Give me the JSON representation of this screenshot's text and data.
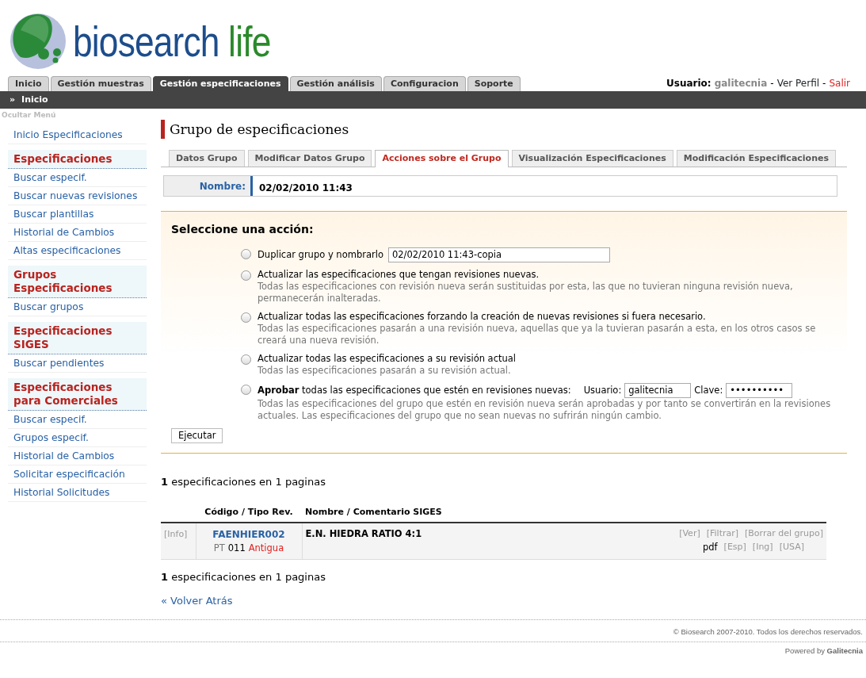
{
  "logo": {
    "word_1": "biosearch",
    "word_2": "life"
  },
  "main_tabs": [
    {
      "label": "Inicio",
      "selected": false
    },
    {
      "label": "Gestión muestras",
      "selected": false
    },
    {
      "label": "Gestión especificaciones",
      "selected": true
    },
    {
      "label": "Gestión análisis",
      "selected": false
    },
    {
      "label": "Configuracion",
      "selected": false
    },
    {
      "label": "Soporte",
      "selected": false
    }
  ],
  "user_bar": {
    "label": "Usuario:",
    "user": "galitecnia",
    "separator_1": "-",
    "profile": "Ver Perfil",
    "separator_2": "-",
    "logout": "Salir"
  },
  "breadcrumb": {
    "arrow": "»",
    "label": "Inicio"
  },
  "hide_menu": "Ocultar Menú",
  "sidebar": {
    "items": [
      {
        "kind": "link",
        "label": "Inicio Especificaciones"
      },
      {
        "kind": "header",
        "label": "Especificaciones"
      },
      {
        "kind": "link",
        "label": "Buscar especif."
      },
      {
        "kind": "link",
        "label": "Buscar nuevas revisiones"
      },
      {
        "kind": "link",
        "label": "Buscar plantillas"
      },
      {
        "kind": "link",
        "label": "Historial de Cambios"
      },
      {
        "kind": "link",
        "label": "Altas especificaciones"
      },
      {
        "kind": "header",
        "label": "Grupos Especificaciones"
      },
      {
        "kind": "link",
        "label": "Buscar grupos"
      },
      {
        "kind": "header",
        "label": "Especificaciones SIGES"
      },
      {
        "kind": "link",
        "label": "Buscar pendientes"
      },
      {
        "kind": "header",
        "label": "Especificaciones para Comerciales"
      },
      {
        "kind": "link",
        "label": "Buscar especif."
      },
      {
        "kind": "link",
        "label": "Grupos especif."
      },
      {
        "kind": "link",
        "label": "Historial de Cambios"
      },
      {
        "kind": "link",
        "label": "Solicitar especificación"
      },
      {
        "kind": "link",
        "label": "Historial Solicitudes"
      }
    ]
  },
  "page_title": "Grupo de especificaciones",
  "group_tabs": [
    {
      "label": "Datos Grupo",
      "selected": false
    },
    {
      "label": "Modificar Datos Grupo",
      "selected": false
    },
    {
      "label": "Acciones sobre el Grupo",
      "selected": true
    },
    {
      "label": "Visualización Especificaciones",
      "selected": false
    },
    {
      "label": "Modificación Especificaciones",
      "selected": false
    }
  ],
  "name_field": {
    "label": "Nombre:",
    "value": "02/02/2010 11:43"
  },
  "actions": {
    "title": "Seleccione una acción:",
    "options": [
      {
        "kind": "duplicate",
        "label": "Duplicar grupo y nombrarlo",
        "selected": false,
        "value": "02/02/2010 11:43-copia"
      },
      {
        "kind": "plain",
        "label": "Actualizar las especificaciones que tengan revisiones nuevas.",
        "selected": false,
        "description": "Todas las especificaciones con revisión nueva serán sustituidas por esta, las que no tuvieran ninguna revisión nueva, permanecerán inalteradas."
      },
      {
        "kind": "plain",
        "label": "Actualizar todas las especificaciones forzando la creación de nuevas revisiones si fuera necesario.",
        "selected": false,
        "description": "Todas las especificaciones pasarán a una revisión nueva, aquellas que ya la tuvieran pasarán a esta, en los otros casos se creará una nueva revisión."
      },
      {
        "kind": "plain",
        "label": "Actualizar todas las especificaciones a su revisión actual",
        "selected": false,
        "description": "Todas las especificaciones pasarán a su revisión actual."
      },
      {
        "kind": "approve",
        "label": "**Aprobar** todas las especificaciones que estén en revisiones nuevas:",
        "selected": false,
        "user_label": "Usuario:",
        "user": "galitecnia",
        "password_label": "Clave:",
        "password": "••••••••••",
        "description": "Todas las especificaciones del grupo que estén en revisión nueva serán aprobadas y por tanto se convertirán en la revisiones actuales. Las especificaciones del grupo que no sean nuevas no sufrirán ningún cambio."
      }
    ],
    "button": "Ejecutar"
  },
  "summary_top": "**1** especificaciones en 1 paginas",
  "table": {
    "columns": [
      "Código / Tipo Rev.",
      "Nombre / Comentario SIGES"
    ],
    "rows": [
      {
        "info": "[Info]",
        "code": "FAENHIER002",
        "type": "PT",
        "number": "011",
        "status": "Antigua",
        "name": "E.N. HIEDRA RATIO 4:1",
        "links_1": [
          "[Ver]",
          "[Filtrar]",
          "[Borrar del grupo]"
        ],
        "links_2": [
          "pdf",
          "[Esp]",
          "[Ing]",
          "[USA]"
        ]
      }
    ]
  },
  "summary_bottom": "**1** especificaciones en 1 paginas",
  "back_link": "« Volver Atrás",
  "footer": {
    "copyright": "© Biosearch 2007-2010. Todos los derechos reservados.",
    "powered": "Powered by **Galitecnia**"
  }
}
